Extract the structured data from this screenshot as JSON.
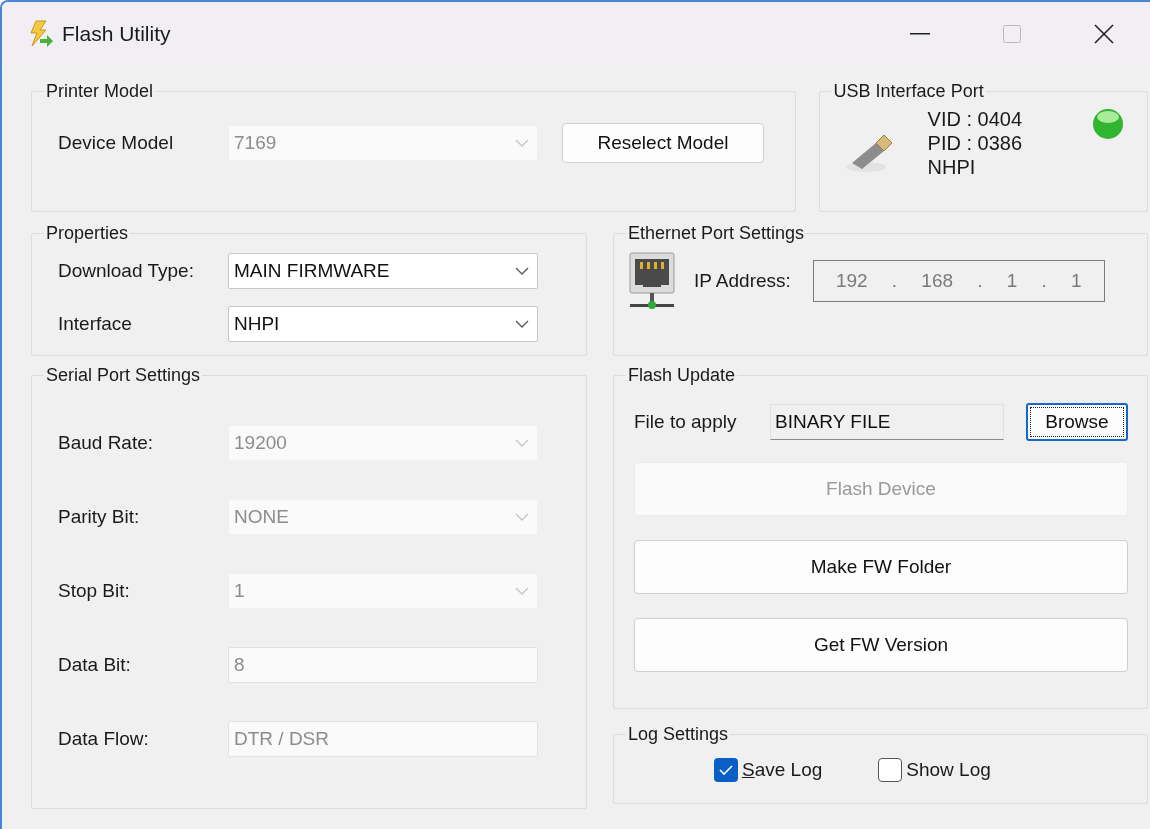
{
  "window": {
    "title": "Flash Utility"
  },
  "printer_model": {
    "title": "Printer Model",
    "field": {
      "label": "Device Model",
      "value": "7169",
      "disabled": true
    },
    "button": "Reselect Model"
  },
  "usb_port": {
    "title": "USB Interface Port",
    "lines": [
      "VID : 0404",
      "PID : 0386",
      "NHPI"
    ],
    "connected": true
  },
  "properties": {
    "title": "Properties",
    "fields": [
      {
        "label": "Download Type:",
        "value": "MAIN FIRMWARE",
        "kind": "dropdown",
        "disabled": false
      },
      {
        "label": "Interface",
        "value": "NHPI",
        "kind": "dropdown",
        "disabled": false
      }
    ]
  },
  "ethernet": {
    "title": "Ethernet Port Settings",
    "label": "IP Address:",
    "ip_parts": [
      "192",
      "168",
      "1",
      "1"
    ],
    "separator": "."
  },
  "serial_port": {
    "title": "Serial Port Settings",
    "fields": [
      {
        "label": "Baud Rate:",
        "value": "19200",
        "kind": "dropdown",
        "disabled": true
      },
      {
        "label": "Parity Bit:",
        "value": "NONE",
        "kind": "dropdown",
        "disabled": true
      },
      {
        "label": "Stop Bit:",
        "value": "1",
        "kind": "dropdown",
        "disabled": true
      },
      {
        "label": "Data Bit:",
        "value": "8",
        "kind": "text",
        "disabled": true
      },
      {
        "label": "Data Flow:",
        "value": "DTR / DSR",
        "kind": "text",
        "disabled": true
      }
    ]
  },
  "flash_update": {
    "title": "Flash Update",
    "file_label": "File to apply",
    "file_value": "BINARY FILE",
    "browse": {
      "label": "Browse",
      "focused": true
    },
    "buttons": [
      {
        "label": "Flash Device",
        "disabled": true
      },
      {
        "label": "Make FW Folder",
        "disabled": false
      },
      {
        "label": "Get FW Version",
        "disabled": false
      }
    ]
  },
  "log_settings": {
    "title": "Log Settings",
    "checkboxes": [
      {
        "label": "Save Log",
        "checked": true,
        "mnemonic": true
      },
      {
        "label": "Show Log",
        "checked": false,
        "mnemonic": false
      }
    ]
  }
}
